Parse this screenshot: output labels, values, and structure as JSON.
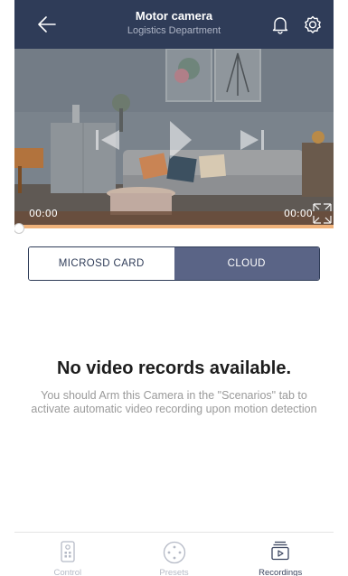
{
  "header": {
    "title": "Motor camera",
    "subtitle": "Logistics Department",
    "icons": [
      "back-arrow-icon",
      "bell-icon",
      "gear-icon"
    ]
  },
  "player": {
    "current_time": "00:00",
    "total_time": "00:00",
    "progress": 0
  },
  "source_tabs": {
    "options": [
      "MICROSD CARD",
      "CLOUD"
    ],
    "selected": "CLOUD"
  },
  "empty_state": {
    "title": "No video records available.",
    "description": "You should Arm this Camera in the \"Scenarios\" tab to activate automatic video recording upon motion detection"
  },
  "tabbar": {
    "items": [
      {
        "label": "Control",
        "icon": "remote-icon"
      },
      {
        "label": "Presets",
        "icon": "presets-icon"
      },
      {
        "label": "Recordings",
        "icon": "recordings-icon"
      }
    ],
    "selected": "Recordings"
  },
  "colors": {
    "header_bg": "#2f3c58",
    "segment_active": "#5a6486",
    "progress": "#f0b27a"
  }
}
